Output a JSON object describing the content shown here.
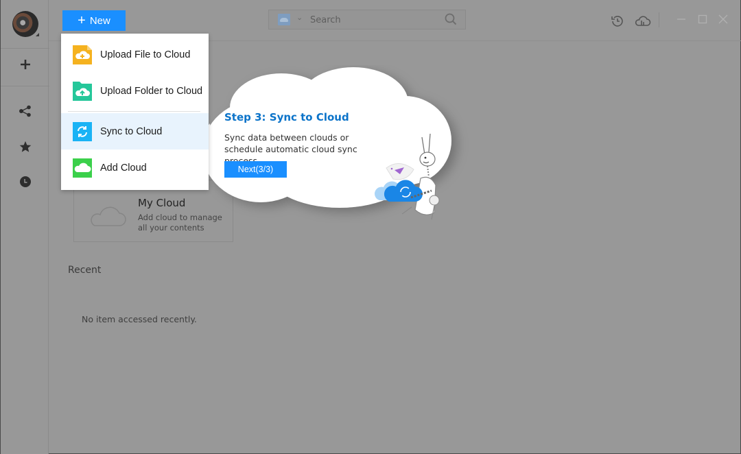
{
  "toolbar": {
    "new_label": "New",
    "search_placeholder": "Search",
    "icons": [
      "history-icon",
      "cloud-transfer-icon"
    ],
    "window_controls": [
      "minimize",
      "maximize",
      "close"
    ]
  },
  "sidebar": {
    "items": [
      {
        "name": "add",
        "icon": "plus-icon"
      },
      {
        "name": "share",
        "icon": "share-icon"
      },
      {
        "name": "favorites",
        "icon": "star-icon"
      },
      {
        "name": "recent",
        "icon": "clock-icon"
      }
    ]
  },
  "new_menu": {
    "items": [
      {
        "label": "Upload File to Cloud",
        "icon": "upload-file-icon",
        "color": "#f5b21f"
      },
      {
        "label": "Upload Folder to Cloud",
        "icon": "upload-folder-icon",
        "color": "#25c79a"
      },
      {
        "label": "Sync to Cloud",
        "icon": "sync-icon",
        "color": "#1ab3f5",
        "active": true
      },
      {
        "label": "Add Cloud",
        "icon": "add-cloud-icon",
        "color": "#3bd04b"
      }
    ]
  },
  "tour": {
    "title": "Step 3: Sync to Cloud",
    "body": "Sync data between clouds or schedule automatic cloud sync process.",
    "next_label": "Next(3/3)"
  },
  "main": {
    "my_cloud": {
      "title": "My Cloud",
      "subtitle": "Add cloud to manage all your contents"
    },
    "recent": {
      "label": "Recent",
      "empty_message": "No item accessed recently."
    }
  },
  "colors": {
    "accent": "#1a8fff",
    "tour_title": "#0b73c9",
    "overlay_bg": "#989898"
  }
}
